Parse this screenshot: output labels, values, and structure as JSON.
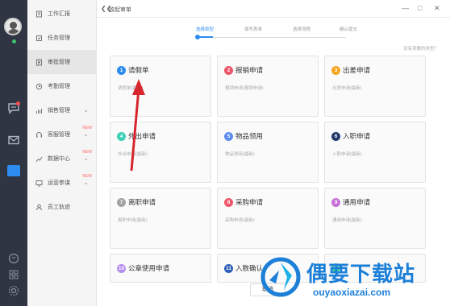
{
  "menu": {
    "items": [
      {
        "label": "工作汇报",
        "icon": "report-icon",
        "has_chevron": false,
        "active": false,
        "new": ""
      },
      {
        "label": "任务管理",
        "icon": "task-icon",
        "has_chevron": false,
        "active": false,
        "new": ""
      },
      {
        "label": "审批管理",
        "icon": "approval-icon",
        "has_chevron": false,
        "active": true,
        "new": ""
      },
      {
        "label": "考勤管理",
        "icon": "attendance-icon",
        "has_chevron": false,
        "active": false,
        "new": ""
      },
      {
        "label": "销售管理",
        "icon": "sales-icon",
        "has_chevron": true,
        "active": false,
        "new": ""
      },
      {
        "label": "客服管理",
        "icon": "service-icon",
        "has_chevron": true,
        "active": false,
        "new": "NEW"
      },
      {
        "label": "数据中心",
        "icon": "data-icon",
        "has_chevron": true,
        "active": false,
        "new": "NEW"
      },
      {
        "label": "运营参谋",
        "icon": "operations-icon",
        "has_chevron": true,
        "active": false,
        "new": "NEW"
      },
      {
        "label": "员工轨迹",
        "icon": "track-icon",
        "has_chevron": false,
        "active": false,
        "new": ""
      }
    ]
  },
  "dialog": {
    "title": "收起审单",
    "back_icon": "collapse-left-icon",
    "steps": [
      {
        "label": "选择类型",
        "active": true
      },
      {
        "label": "填写表单",
        "active": false
      },
      {
        "label": "选择流程",
        "active": false
      },
      {
        "label": "确认提交",
        "active": false
      }
    ],
    "hint": "没有我要的类型？",
    "cancel_label": "取消"
  },
  "cards": [
    {
      "num": "1",
      "title": "请假单",
      "desc": "请假单(最新)",
      "color": "#2d8cf0"
    },
    {
      "num": "2",
      "title": "报销申请",
      "desc": "报销申请(报销申请)",
      "color": "#f0566b"
    },
    {
      "num": "3",
      "title": "出差申请",
      "desc": "出差申请(最新)",
      "color": "#f5a623"
    },
    {
      "num": "4",
      "title": "外出申请",
      "desc": "外出申请(最新)",
      "color": "#3ccfb6"
    },
    {
      "num": "5",
      "title": "物品领用",
      "desc": "物品领用(最新)",
      "color": "#5b8def"
    },
    {
      "num": "6",
      "title": "入职申请",
      "desc": "入职申请(最新)",
      "color": "#1f3a6b"
    },
    {
      "num": "7",
      "title": "离职申请",
      "desc": "离职申请(最新)",
      "color": "#a3a3a3"
    },
    {
      "num": "8",
      "title": "采购申请",
      "desc": "采购申请(最新)",
      "color": "#f0566b"
    },
    {
      "num": "9",
      "title": "通用申请",
      "desc": "通用申请(最新)",
      "color": "#c86fd8"
    },
    {
      "num": "10",
      "title": "公章使用申请",
      "desc": "",
      "color": "#b38df0"
    },
    {
      "num": "11",
      "title": "入数确认",
      "desc": "",
      "color": "#2d5fb8"
    },
    {
      "num": "12",
      "title": "",
      "desc": "",
      "color": "#3ccf8e"
    }
  ],
  "watermark": {
    "text": "偶要下载站",
    "url": "ouyaoxiazai.com"
  },
  "colors": {
    "accent": "#2d8cf0",
    "arrow": "#d7262d",
    "rail": "#2f3542"
  }
}
